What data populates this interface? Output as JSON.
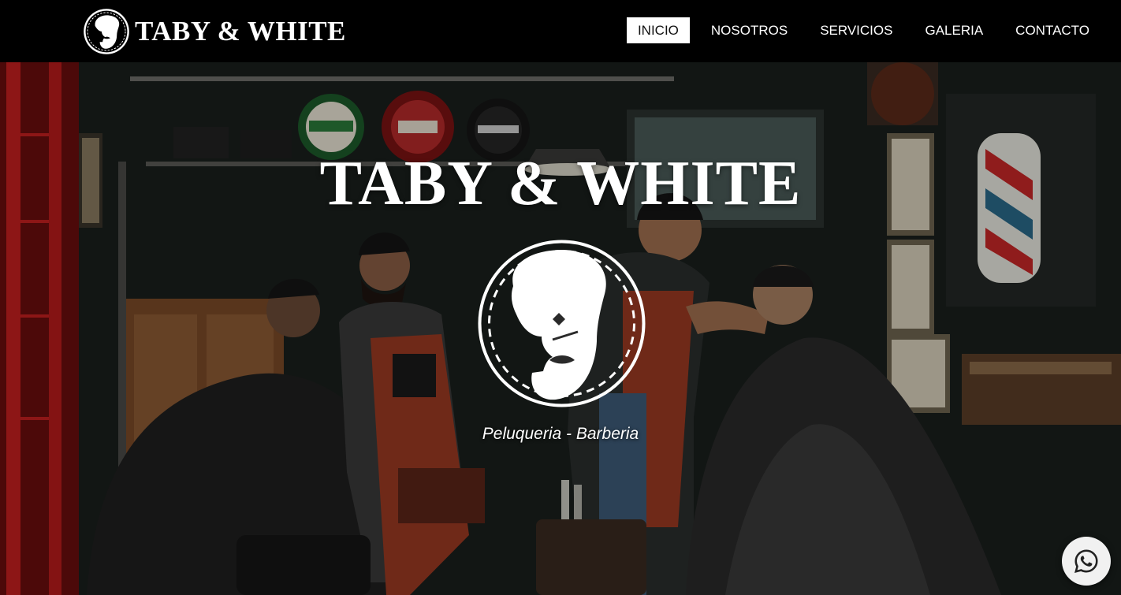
{
  "brand": {
    "name": "TABY & WHITE",
    "logo_icon": "bearded-man-logo-icon"
  },
  "nav": {
    "items": [
      {
        "label": "INICIO",
        "active": true
      },
      {
        "label": "NOSOTROS",
        "active": false
      },
      {
        "label": "SERVICIOS",
        "active": false
      },
      {
        "label": "GALERIA",
        "active": false
      },
      {
        "label": "CONTACTO",
        "active": false
      }
    ]
  },
  "hero": {
    "title": "TABY & WHITE",
    "emblem_icon": "bearded-man-emblem-icon",
    "tagline": "Peluqueria - Barberia",
    "background_subject": "barbershop-photo"
  },
  "whatsapp": {
    "icon": "whatsapp-icon",
    "color": "#e8e8e8"
  },
  "colors": {
    "navbar_bg": "#000000",
    "text": "#ffffff",
    "accent_red": "#c62828"
  }
}
